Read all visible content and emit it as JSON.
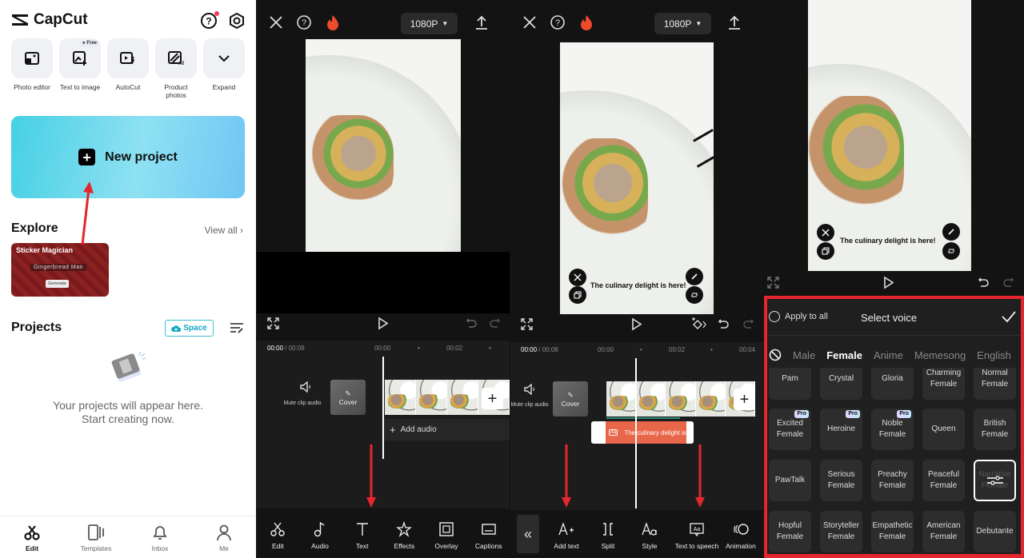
{
  "home": {
    "brand": "CapCut",
    "tools": [
      {
        "label": "Photo editor",
        "icon": "photo-editor-icon"
      },
      {
        "label": "Text to image",
        "icon": "text-to-image-icon",
        "badge": "Free"
      },
      {
        "label": "AutoCut",
        "icon": "autocut-icon"
      },
      {
        "label": "Product photos",
        "icon": "product-photos-icon"
      },
      {
        "label": "Expand",
        "icon": "chevron-down-icon"
      }
    ],
    "new_project": "New project",
    "explore": {
      "title": "Explore",
      "view_all": "View all",
      "card_title": "Sticker Magician",
      "card_prompt": "Gingerbread Man",
      "card_button": "Generate"
    },
    "projects": {
      "title": "Projects",
      "space_label": "Space",
      "empty_line1": "Your projects will appear here.",
      "empty_line2": "Start creating now."
    },
    "nav": [
      {
        "label": "Edit",
        "active": true
      },
      {
        "label": "Templates",
        "active": false
      },
      {
        "label": "Inbox",
        "active": false
      },
      {
        "label": "Me",
        "active": false
      }
    ]
  },
  "editor1": {
    "resolution": "1080P",
    "time_current": "00:00",
    "time_total": "/ 00:08",
    "ruler": [
      "00:00",
      "00:02"
    ],
    "mute_label": "Mute clip audio",
    "cover_label": "Cover",
    "add_audio": "Add audio",
    "toolbar": [
      "Edit",
      "Audio",
      "Text",
      "Effects",
      "Overlay",
      "Captions"
    ]
  },
  "editor2": {
    "resolution": "1080P",
    "caption": "The culinary delight is here!",
    "time_current": "00:00",
    "time_total": "/ 00:08",
    "ruler": [
      "00:00",
      "00:02",
      "00:04"
    ],
    "mute_label": "Mute clip audio",
    "cover_label": "Cover",
    "text_clip": "The culinary delight is here!",
    "toolbar": [
      "Add text",
      "Split",
      "Style",
      "Text to speech",
      "Animation"
    ]
  },
  "editor3": {
    "caption": "The culinary delight is here!",
    "voice_panel": {
      "apply_all": "Apply to all",
      "title": "Select voice",
      "tabs": [
        "Male",
        "Female",
        "Anime",
        "Memesong",
        "English"
      ],
      "active_tab": "Female",
      "voices": [
        {
          "name": "Pam",
          "pro": true
        },
        {
          "name": "Crystal",
          "pro": true
        },
        {
          "name": "Gloria",
          "pro": true
        },
        {
          "name": "Charming Female",
          "pro": false
        },
        {
          "name": "Normal Female",
          "pro": false
        },
        {
          "name": "Excited Female",
          "pro": true
        },
        {
          "name": "Heroine",
          "pro": true
        },
        {
          "name": "Noble Female",
          "pro": true
        },
        {
          "name": "Queen",
          "pro": false
        },
        {
          "name": "British Female",
          "pro": false
        },
        {
          "name": "PawTalk",
          "pro": false
        },
        {
          "name": "Serious Female",
          "pro": false
        },
        {
          "name": "Preachy Female",
          "pro": false
        },
        {
          "name": "Peaceful Female",
          "pro": false
        },
        {
          "name": "Narrative Female",
          "pro": false,
          "selected": true
        },
        {
          "name": "Hopful Female",
          "pro": false
        },
        {
          "name": "Storyteller Female",
          "pro": false
        },
        {
          "name": "Empathetic Female",
          "pro": false
        },
        {
          "name": "American Female",
          "pro": false
        },
        {
          "name": "Debutante",
          "pro": false
        }
      ],
      "pro_label": "Pro"
    }
  },
  "colors": {
    "accent_red": "#e5262c",
    "text_clip": "#e8664a",
    "space_cyan": "#16a7c4"
  }
}
